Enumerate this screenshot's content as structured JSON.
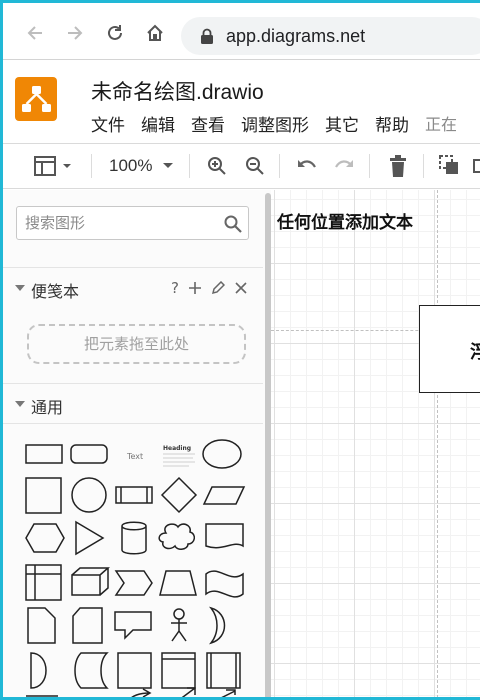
{
  "browser": {
    "url": "app.diagrams.net"
  },
  "app": {
    "title": "未命名绘图.drawio",
    "menu": [
      "文件",
      "编辑",
      "查看",
      "调整图形",
      "其它",
      "帮助"
    ],
    "status": "正在"
  },
  "toolbar": {
    "zoom": "100%"
  },
  "sidebar": {
    "search_placeholder": "搜索图形",
    "scratchpad_title": "便笺本",
    "scratchpad_help": "?",
    "dropzone": "把元素拖至此处",
    "general_title": "通用",
    "text_shape_label": "Text",
    "heading_shape_label": "Heading"
  },
  "canvas": {
    "text": "任何位置添加文本",
    "box_text": "浮"
  },
  "colors": {
    "accent_border": "#21b8d6",
    "logo": "#f08705"
  }
}
